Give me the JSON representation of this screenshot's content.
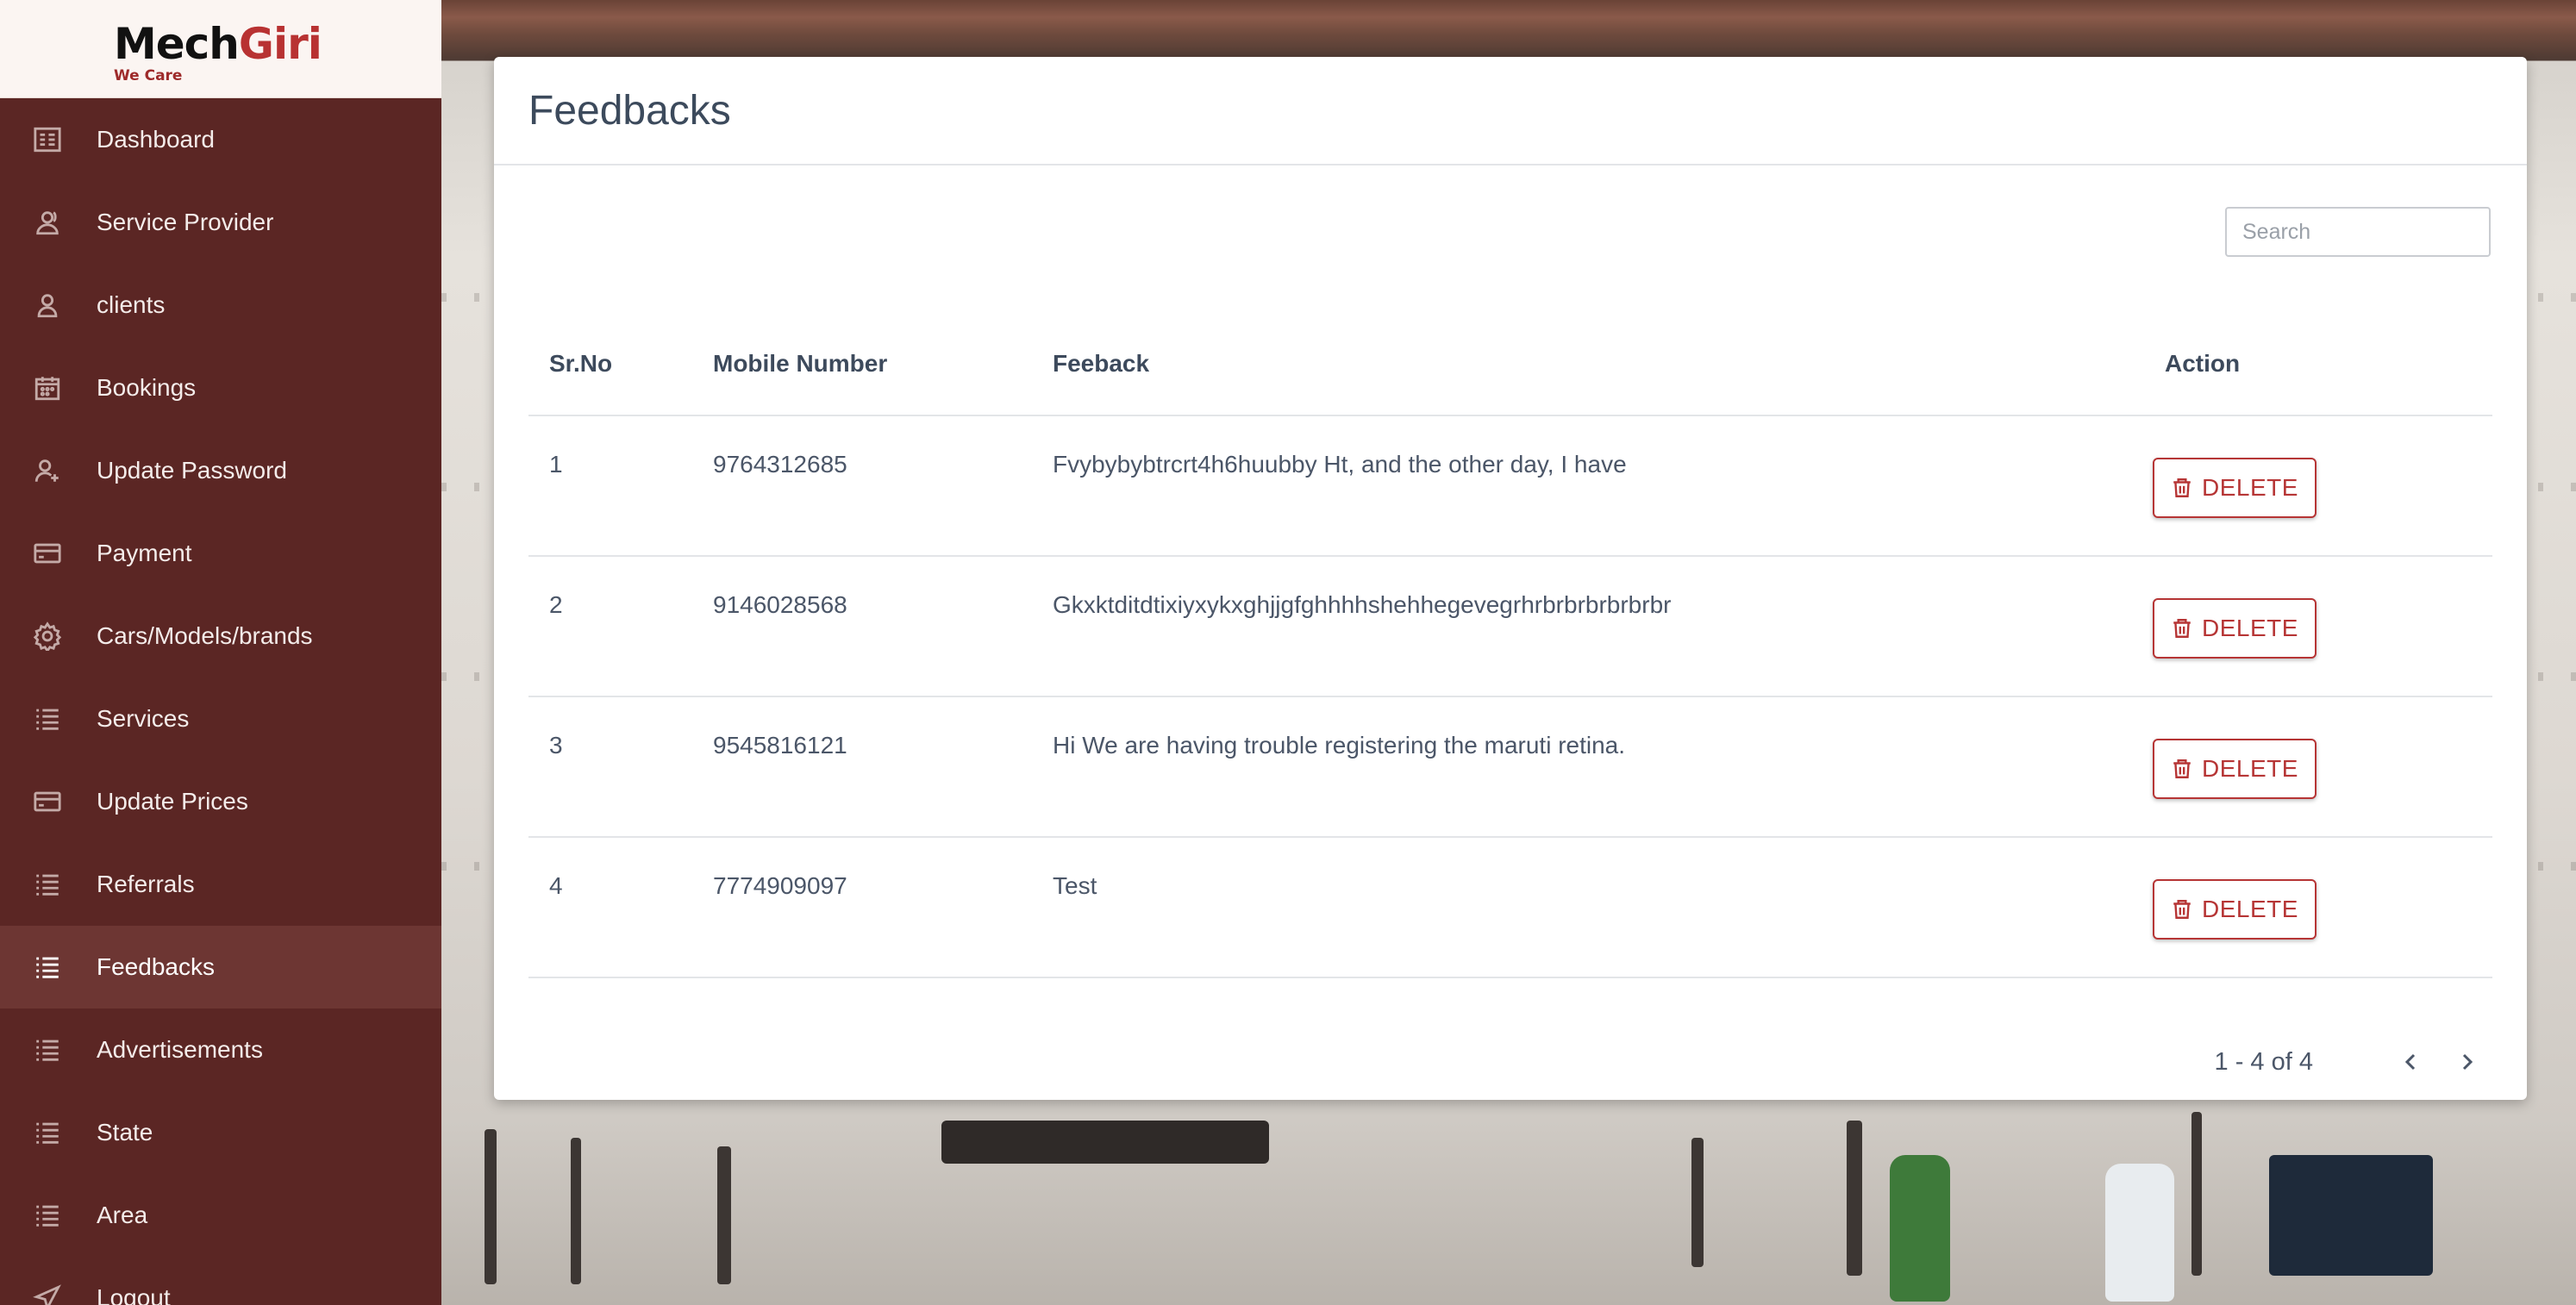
{
  "brand": {
    "name_part1": "Mech",
    "name_part2": "Giri",
    "tagline": "We Care"
  },
  "sidebar": {
    "items": [
      {
        "label": "Dashboard",
        "icon": "dashboard-icon",
        "active": false
      },
      {
        "label": "Service Provider",
        "icon": "users-icon",
        "active": false
      },
      {
        "label": "clients",
        "icon": "user-icon",
        "active": false
      },
      {
        "label": "Bookings",
        "icon": "calendar-icon",
        "active": false
      },
      {
        "label": "Update Password",
        "icon": "user-plus-icon",
        "active": false
      },
      {
        "label": "Payment",
        "icon": "credit-card-icon",
        "active": false
      },
      {
        "label": "Cars/Models/brands",
        "icon": "gear-icon",
        "active": false
      },
      {
        "label": "Services",
        "icon": "list-icon",
        "active": false
      },
      {
        "label": "Update Prices",
        "icon": "credit-card-icon",
        "active": false
      },
      {
        "label": "Referrals",
        "icon": "list-icon",
        "active": false
      },
      {
        "label": "Feedbacks",
        "icon": "list-icon",
        "active": true
      },
      {
        "label": "Advertisements",
        "icon": "list-icon",
        "active": false
      },
      {
        "label": "State",
        "icon": "list-icon",
        "active": false
      },
      {
        "label": "Area",
        "icon": "list-icon",
        "active": false
      },
      {
        "label": "Logout",
        "icon": "logout-icon",
        "active": false
      }
    ]
  },
  "page": {
    "title": "Feedbacks"
  },
  "search": {
    "placeholder": "Search",
    "value": ""
  },
  "table": {
    "headers": {
      "sr": "Sr.No",
      "mobile": "Mobile Number",
      "feedback": "Feeback",
      "action": "Action"
    },
    "rows": [
      {
        "sr": "1",
        "mobile": "9764312685",
        "feedback": "Fvybybybtrcrt4h6huubby Ht, and the other day, I have",
        "action": "DELETE"
      },
      {
        "sr": "2",
        "mobile": "9146028568",
        "feedback": "Gkxktditdtixiyxykxghjjgfghhhhshehhegevegrhrbrbrbrbrbrbr",
        "action": "DELETE"
      },
      {
        "sr": "3",
        "mobile": "9545816121",
        "feedback": "Hi We are having trouble registering the maruti retina.",
        "action": "DELETE"
      },
      {
        "sr": "4",
        "mobile": "7774909097",
        "feedback": "Test",
        "action": "DELETE"
      }
    ]
  },
  "pagination": {
    "range": "1 - 4 of 4"
  },
  "colors": {
    "sidebar_bg": "#5b2624",
    "sidebar_active": "#6d3633",
    "brand_accent": "#b83232",
    "delete": "#b63535"
  }
}
